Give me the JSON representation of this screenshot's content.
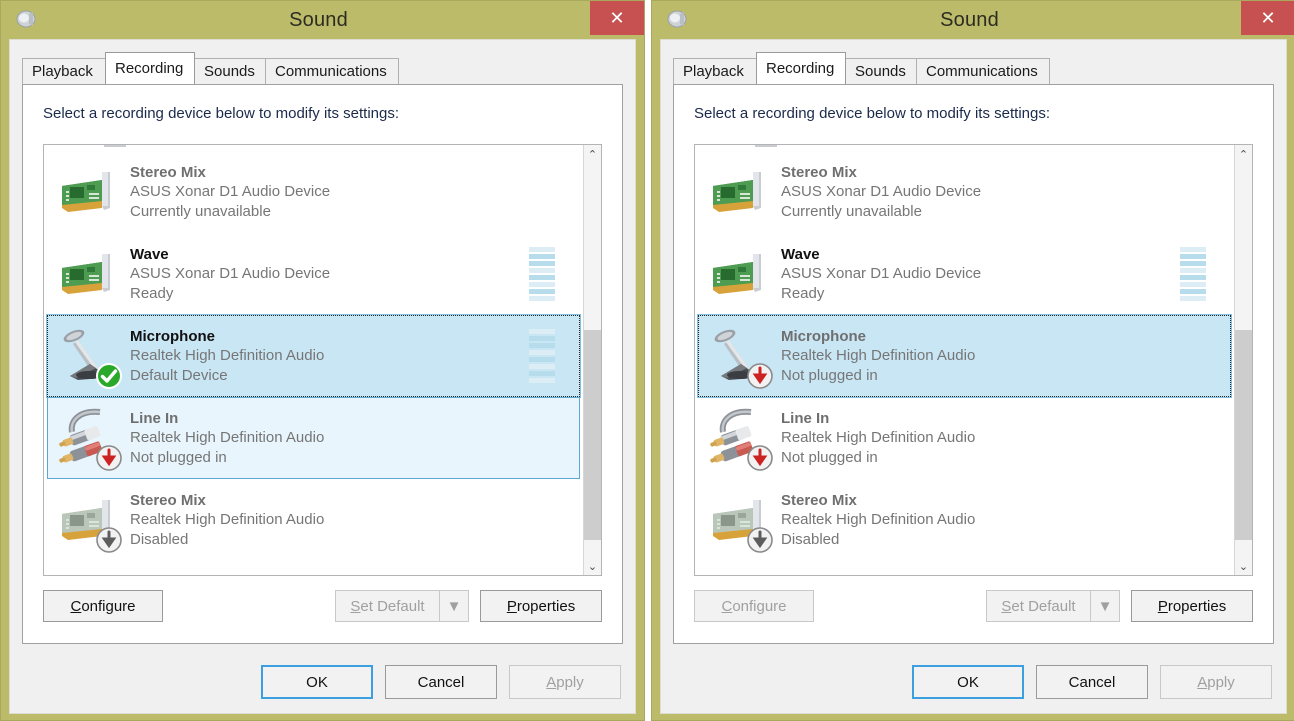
{
  "window": {
    "title": "Sound",
    "icon": "speaker-icon",
    "close_label": "✕",
    "titlebar_color": "#bcbb6a",
    "close_color": "#c75050"
  },
  "tabs": [
    {
      "label": "Playback",
      "active": false
    },
    {
      "label": "Recording",
      "active": true
    },
    {
      "label": "Sounds",
      "active": false
    },
    {
      "label": "Communications",
      "active": false
    }
  ],
  "instruction": "Select a recording device below to modify its settings:",
  "scrollbar": {
    "up_glyph": "⌃",
    "down_glyph": "⌄"
  },
  "left_window": {
    "devices": [
      {
        "icon": "pci-audio-card-icon",
        "name": "Stereo Mix",
        "driver": "ASUS Xonar D1 Audio Device",
        "status": "Currently unavailable",
        "badge": "none",
        "state": "normal",
        "meter": false
      },
      {
        "icon": "pci-audio-card-icon",
        "name": "Wave",
        "driver": "ASUS Xonar D1 Audio Device",
        "status": "Ready",
        "badge": "none",
        "state": "normal",
        "meter": true
      },
      {
        "icon": "microphone-icon",
        "name": "Microphone",
        "driver": "Realtek High Definition Audio",
        "status": "Default Device",
        "badge": "green-check-badge",
        "state": "selected",
        "meter": true
      },
      {
        "icon": "rca-line-in-icon",
        "name": "Line In",
        "driver": "Realtek High Definition Audio",
        "status": "Not plugged in",
        "badge": "red-arrow-badge",
        "state": "hovered",
        "meter": false
      },
      {
        "icon": "pci-audio-card-icon",
        "name": "Stereo Mix",
        "driver": "Realtek High Definition Audio",
        "status": "Disabled",
        "badge": "grey-arrow-badge",
        "state": "normal",
        "meter": false
      }
    ],
    "buttons": {
      "configure": {
        "label": "Configure",
        "accel": "C",
        "disabled": false
      },
      "set_default": {
        "label": "Set Default",
        "accel": "S",
        "disabled": true
      },
      "dropdown": {
        "label": "▼",
        "disabled": true
      },
      "properties": {
        "label": "Properties",
        "accel": "P",
        "disabled": false
      }
    },
    "footer": {
      "ok": {
        "label": "OK",
        "disabled": false,
        "focused": true
      },
      "cancel": {
        "label": "Cancel",
        "disabled": false,
        "focused": false
      },
      "apply": {
        "label": "Apply",
        "accel": "A",
        "disabled": true,
        "focused": false
      }
    }
  },
  "right_window": {
    "devices": [
      {
        "icon": "pci-audio-card-icon",
        "name": "Stereo Mix",
        "driver": "ASUS Xonar D1 Audio Device",
        "status": "Currently unavailable",
        "badge": "none",
        "state": "normal",
        "meter": false
      },
      {
        "icon": "pci-audio-card-icon",
        "name": "Wave",
        "driver": "ASUS Xonar D1 Audio Device",
        "status": "Ready",
        "badge": "none",
        "state": "normal",
        "meter": true
      },
      {
        "icon": "microphone-icon",
        "name": "Microphone",
        "driver": "Realtek High Definition Audio",
        "status": "Not plugged in",
        "badge": "red-arrow-badge",
        "state": "selected",
        "meter": false
      },
      {
        "icon": "rca-line-in-icon",
        "name": "Line In",
        "driver": "Realtek High Definition Audio",
        "status": "Not plugged in",
        "badge": "red-arrow-badge",
        "state": "normal",
        "meter": false
      },
      {
        "icon": "pci-audio-card-icon",
        "name": "Stereo Mix",
        "driver": "Realtek High Definition Audio",
        "status": "Disabled",
        "badge": "grey-arrow-badge",
        "state": "normal",
        "meter": false
      }
    ],
    "buttons": {
      "configure": {
        "label": "Configure",
        "accel": "C",
        "disabled": true
      },
      "set_default": {
        "label": "Set Default",
        "accel": "S",
        "disabled": true
      },
      "dropdown": {
        "label": "▼",
        "disabled": true
      },
      "properties": {
        "label": "Properties",
        "accel": "P",
        "disabled": false
      }
    },
    "footer": {
      "ok": {
        "label": "OK",
        "disabled": false,
        "focused": true
      },
      "cancel": {
        "label": "Cancel",
        "disabled": false,
        "focused": false
      },
      "apply": {
        "label": "Apply",
        "accel": "A",
        "disabled": true,
        "focused": false
      }
    }
  }
}
